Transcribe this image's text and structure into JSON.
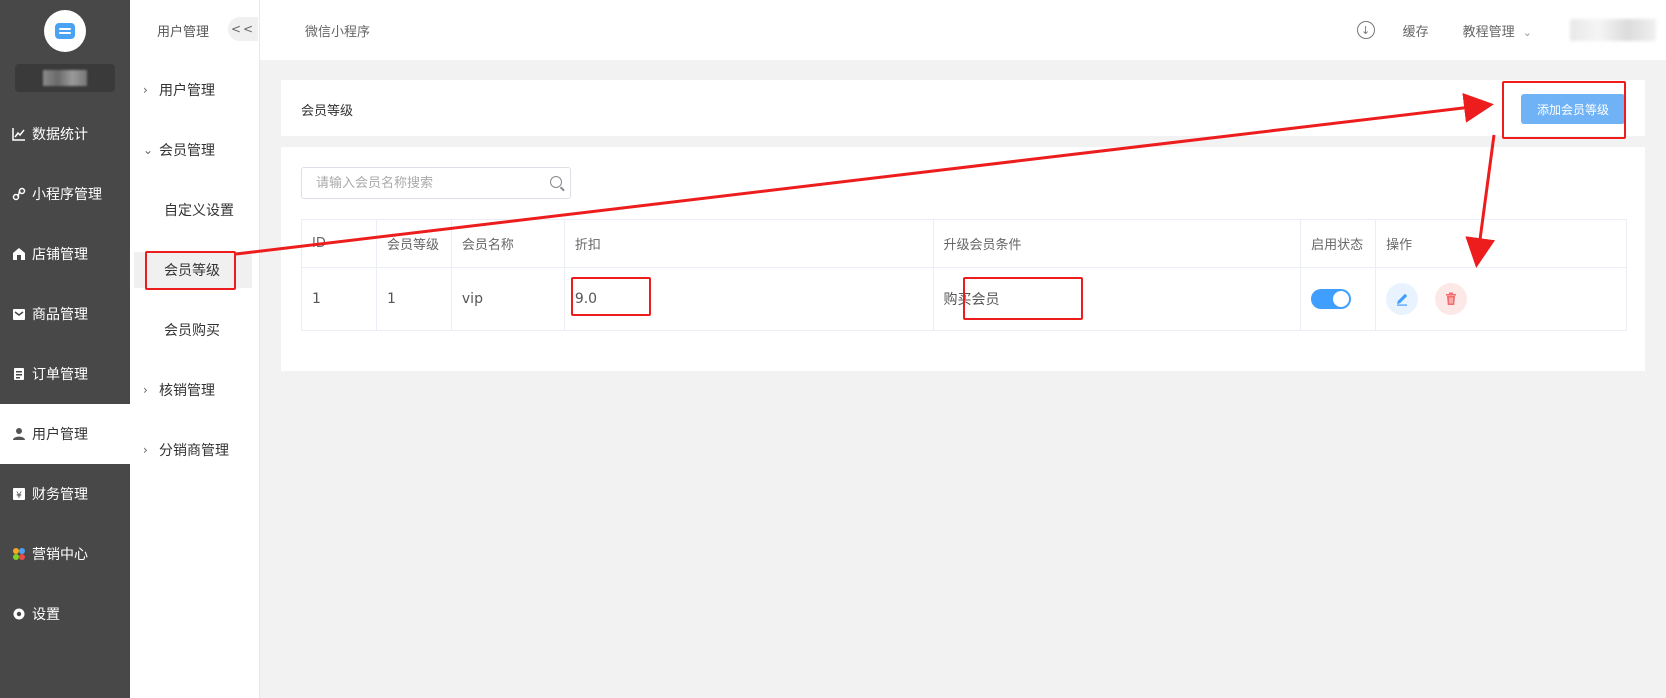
{
  "sidebar": {
    "items": [
      {
        "label": "数据统计",
        "icon": "chart-line-icon"
      },
      {
        "label": "小程序管理",
        "icon": "miniprogram-icon"
      },
      {
        "label": "店铺管理",
        "icon": "store-icon"
      },
      {
        "label": "商品管理",
        "icon": "goods-icon"
      },
      {
        "label": "订单管理",
        "icon": "order-icon"
      },
      {
        "label": "用户管理",
        "icon": "user-icon",
        "active": true
      },
      {
        "label": "财务管理",
        "icon": "finance-icon"
      },
      {
        "label": "营销中心",
        "icon": "marketing-icon"
      },
      {
        "label": "设置",
        "icon": "settings-icon"
      }
    ]
  },
  "submenu": {
    "title": "用户管理",
    "collapse": "<<",
    "groups": [
      {
        "label": "用户管理",
        "expanded": false
      },
      {
        "label": "会员管理",
        "expanded": true,
        "children": [
          "自定义设置",
          "会员等级",
          "会员购买"
        ]
      },
      {
        "label": "核销管理",
        "expanded": false
      },
      {
        "label": "分销商管理",
        "expanded": false
      }
    ]
  },
  "header": {
    "breadcrumb": "微信小程序",
    "cache": "缓存",
    "tutorial": "教程管理"
  },
  "page": {
    "title": "会员等级",
    "add_button": "添加会员等级",
    "search_placeholder": "请输入会员名称搜索"
  },
  "table": {
    "columns": [
      "ID",
      "会员等级",
      "会员名称",
      "折扣",
      "升级会员条件",
      "启用状态",
      "操作"
    ],
    "rows": [
      {
        "id": "1",
        "level": "1",
        "name": "vip",
        "discount": "9.0",
        "condition": "购买会员",
        "enabled": true
      }
    ]
  },
  "colors": {
    "primary": "#409eff",
    "button": "#6fb2f5",
    "sidebar": "#484848",
    "annotation": "#ee1d1d",
    "delete": "#f56c6c"
  }
}
